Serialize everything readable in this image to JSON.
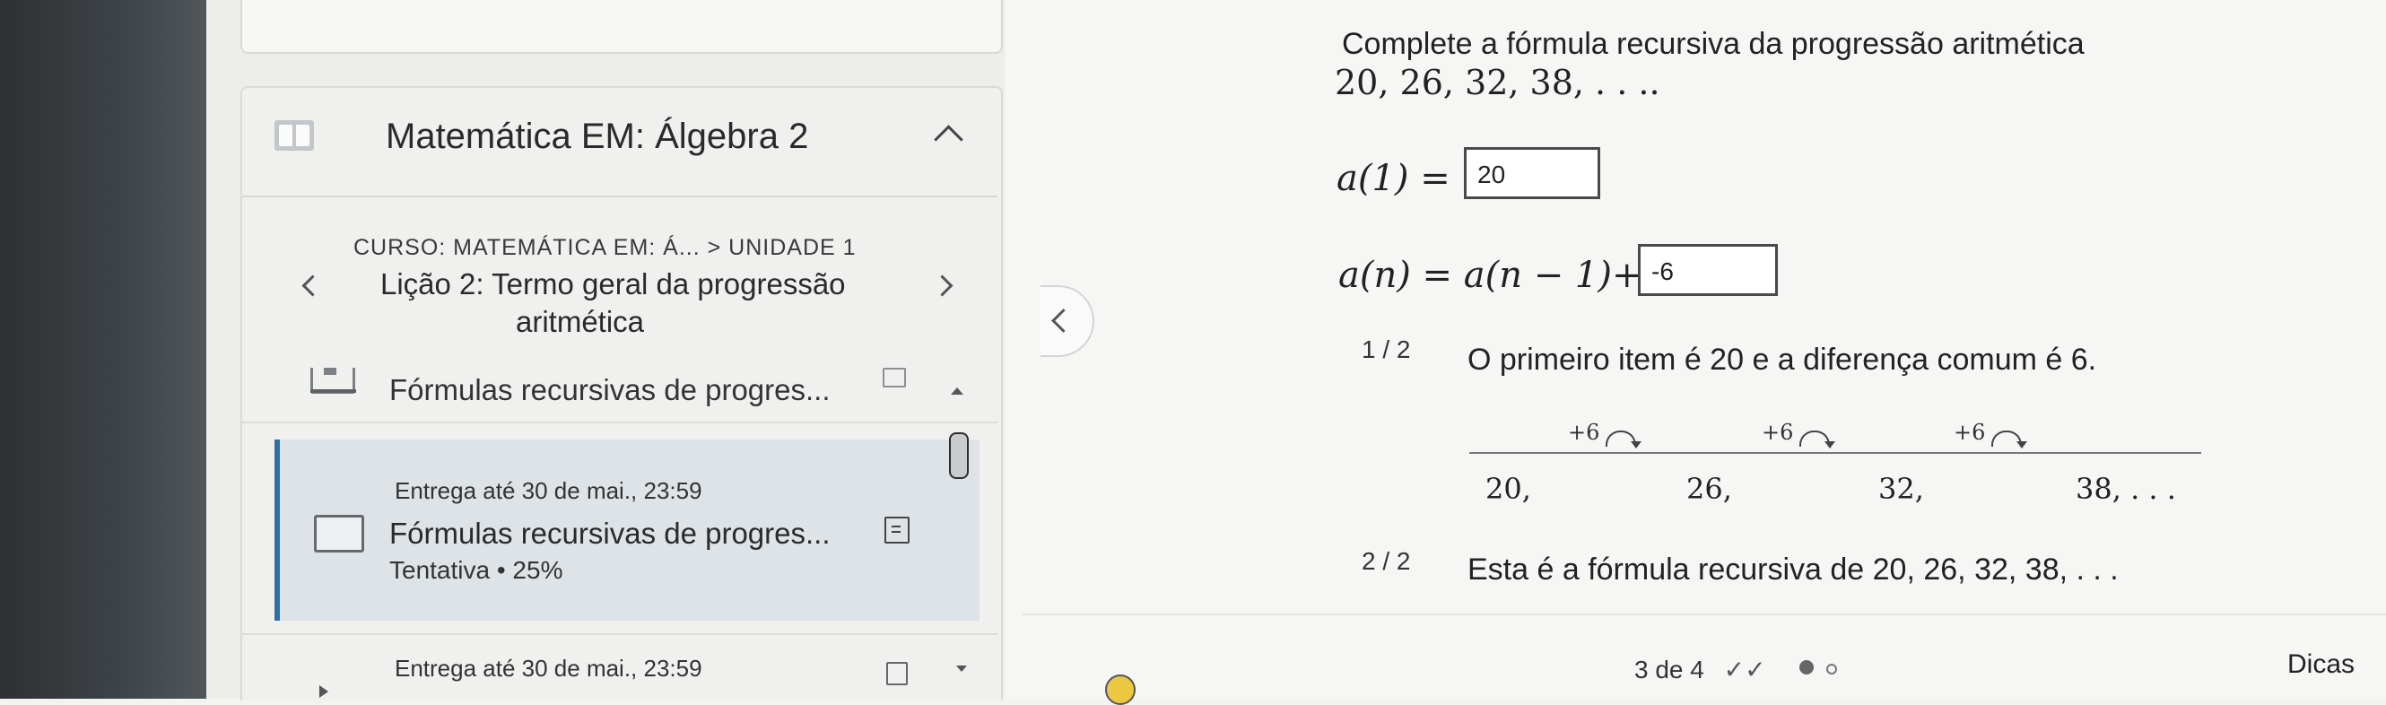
{
  "sidebar": {
    "course": {
      "icon": "book-icon",
      "title": "Matemática EM: Álgebra 2"
    },
    "breadcrumb": "CURSO: MATEMÁTICA EM: Á... > UNIDADE 1",
    "lesson": {
      "line1": "Lição 2: Termo geral da progressão",
      "line2": "aritmética"
    },
    "section": {
      "title": "Fórmulas recursivas de progres..."
    },
    "active_item": {
      "due": "Entrega até 30 de mai., 23:59",
      "title": "Fórmulas recursivas de progres...",
      "attempt": "Tentativa • 25%"
    },
    "next_item": {
      "due": "Entrega até 30 de mai., 23:59"
    }
  },
  "question": {
    "line1": "Complete a fórmula recursiva da progressão aritmética",
    "line2": "20, 26, 32, 38, . . ..",
    "eq1_lhs": "a(1) =",
    "eq1_answer": "20",
    "eq2_lhs": "a(n) = a(n − 1)+",
    "eq2_answer": "-6"
  },
  "hints": {
    "step1": {
      "counter": "1 / 2",
      "text": "O primeiro item é 20 e a diferença comum é 6."
    },
    "sequence": {
      "increments": [
        "+6",
        "+6",
        "+6"
      ],
      "terms": [
        "20,",
        "26,",
        "32,",
        "38, . . ."
      ]
    },
    "step2": {
      "counter": "2 / 2",
      "text": "Esta é a fórmula recursiva de 20, 26, 32, 38, . . ."
    }
  },
  "footer": {
    "progress": "3 de 4",
    "check_marks": "✓✓",
    "hints_button": "Dicas"
  }
}
